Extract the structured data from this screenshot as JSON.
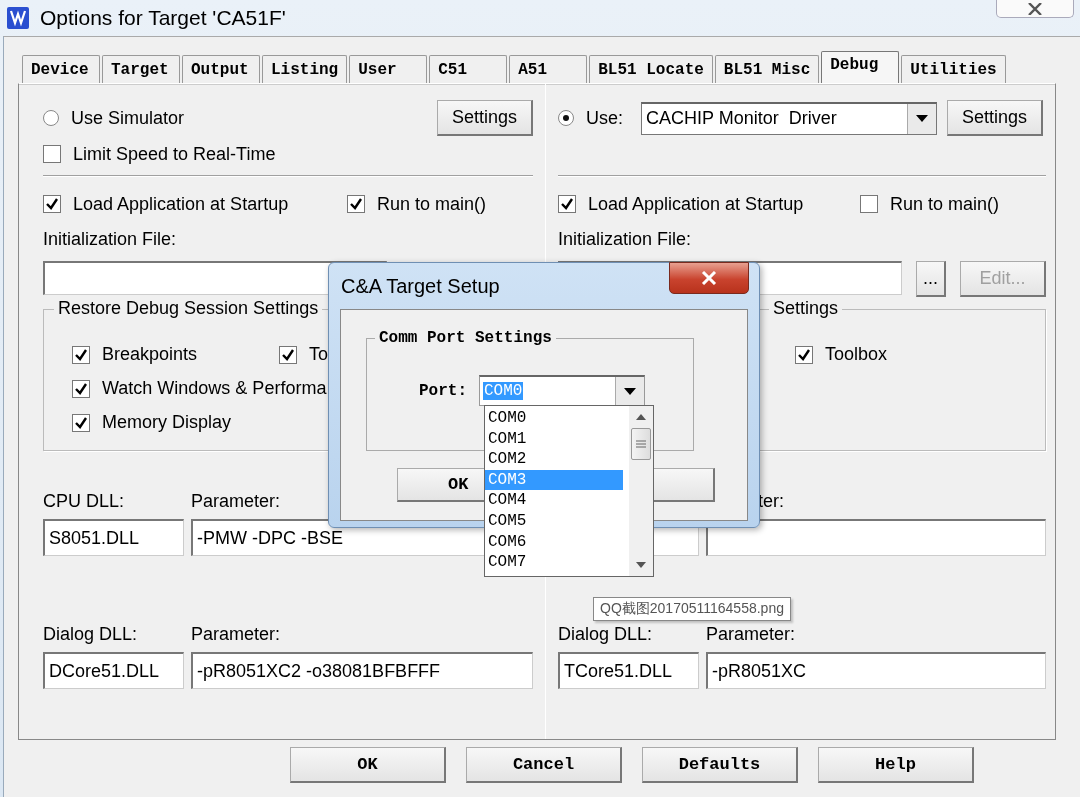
{
  "window": {
    "title": "Options for Target 'CA51F'"
  },
  "tabs": [
    {
      "label": "Device",
      "selected": false
    },
    {
      "label": "Target",
      "selected": false
    },
    {
      "label": "Output",
      "selected": false
    },
    {
      "label": "Listing",
      "selected": false
    },
    {
      "label": "User",
      "selected": false
    },
    {
      "label": "C51",
      "selected": false
    },
    {
      "label": "A51",
      "selected": false
    },
    {
      "label": "BL51 Locate",
      "selected": false
    },
    {
      "label": "BL51 Misc",
      "selected": false
    },
    {
      "label": "Debug",
      "selected": true
    },
    {
      "label": "Utilities",
      "selected": false
    }
  ],
  "left": {
    "mode": {
      "label": "Use Simulator",
      "selected": false
    },
    "settings_button": "Settings",
    "limit_speed": {
      "label": "Limit Speed to Real-Time",
      "checked": false
    },
    "load_app": {
      "label": "Load Application at Startup",
      "checked": true
    },
    "run_to_main": {
      "label": "Run to main()",
      "checked": true
    },
    "init_file_label": "Initialization File:",
    "restore_group": {
      "title": "Restore Debug Session Settings",
      "items": [
        {
          "label": "Breakpoints",
          "checked": true
        },
        {
          "label": "To",
          "checked": true
        },
        {
          "label": "Watch Windows & Performa",
          "checked": true
        },
        {
          "label": "Memory Display",
          "checked": true
        }
      ]
    },
    "cpu_dll": {
      "label": "CPU DLL:",
      "value": "S8051.DLL",
      "param_label": "Parameter:",
      "param_value": "-PMW -DPC -BSE"
    },
    "dialog_dll": {
      "label": "Dialog DLL:",
      "value": "DCore51.DLL",
      "param_label": "Parameter:",
      "param_value": "-pR8051XC2 -o38081BFBFFF"
    }
  },
  "right": {
    "mode": {
      "label": "Use:",
      "selected": true
    },
    "driver": "CACHIP Monitor  Driver",
    "settings_button": "Settings",
    "load_app": {
      "label": "Load Application at Startup",
      "checked": true
    },
    "run_to_main": {
      "label": "Run to main()",
      "checked": false
    },
    "init_file_label": "Initialization File:",
    "browse_button": "...",
    "edit_button": {
      "label": "Edit...",
      "disabled": true
    },
    "restore_group": {
      "title": "Settings",
      "items": [
        {
          "label": "Toolbox",
          "checked": true
        }
      ]
    },
    "cpu_dll": {
      "param_label": "ter:"
    },
    "dialog_dll": {
      "label": "Dialog DLL:",
      "value": "TCore51.DLL",
      "param_label": "Parameter:",
      "param_value": "-pR8051XC"
    }
  },
  "buttons": [
    "OK",
    "Cancel",
    "Defaults",
    "Help"
  ],
  "popup": {
    "title": "C&A Target Setup",
    "group": "Comm Port Settings",
    "port_label": "Port:",
    "port_value": "COM0",
    "ok": "OK",
    "ports": [
      {
        "label": "COM0",
        "selected": false
      },
      {
        "label": "COM1",
        "selected": false
      },
      {
        "label": "COM2",
        "selected": false
      },
      {
        "label": "COM3",
        "selected": true
      },
      {
        "label": "COM4",
        "selected": false
      },
      {
        "label": "COM5",
        "selected": false
      },
      {
        "label": "COM6",
        "selected": false
      },
      {
        "label": "COM7",
        "selected": false
      }
    ]
  },
  "tooltip": "QQ截图20170511164558.png"
}
